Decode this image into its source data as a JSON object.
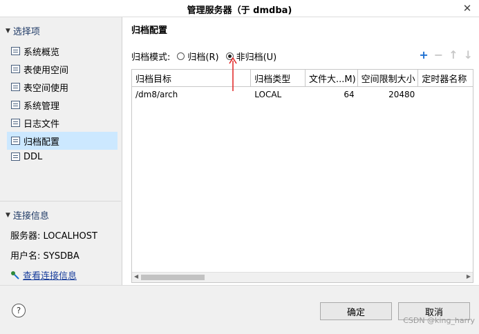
{
  "window": {
    "title": "管理服务器（于 dmdba)",
    "close_glyph": "✕"
  },
  "sidebar": {
    "section_title": "选择项",
    "items": [
      {
        "label": "系统概览",
        "active": false
      },
      {
        "label": "表使用空间",
        "active": false
      },
      {
        "label": "表空间使用",
        "active": false
      },
      {
        "label": "系统管理",
        "active": false
      },
      {
        "label": "日志文件",
        "active": false
      },
      {
        "label": "归档配置",
        "active": true
      },
      {
        "label": "DDL",
        "active": false
      }
    ],
    "connection": {
      "section_title": "连接信息",
      "server": "服务器: LOCALHOST",
      "user": "用户名: SYSDBA",
      "view_link": "查看连接信息"
    }
  },
  "main": {
    "title": "归档配置",
    "mode_label": "归档模式:",
    "radio_archive": "归档(R)",
    "radio_noarchive": "非归档(U)",
    "selected_mode": "noarchive",
    "toolbar": {
      "add": "+",
      "remove": "−",
      "up": "↑",
      "down": "↓"
    },
    "table": {
      "columns": [
        "归档目标",
        "归档类型",
        "文件大...M)",
        "空间限制大小",
        "定时器名称"
      ],
      "rows": [
        {
          "target": "/dm8/arch",
          "type": "LOCAL",
          "file_size": "64",
          "space_limit": "20480",
          "timer": ""
        }
      ]
    }
  },
  "buttons": {
    "ok": "确定",
    "cancel": "取消",
    "help": "?"
  },
  "watermark": "CSDN @king_harry",
  "colors": {
    "accent": "#1c6fd1",
    "selection": "#cce8ff",
    "annotation_arrow": "#e02020"
  }
}
